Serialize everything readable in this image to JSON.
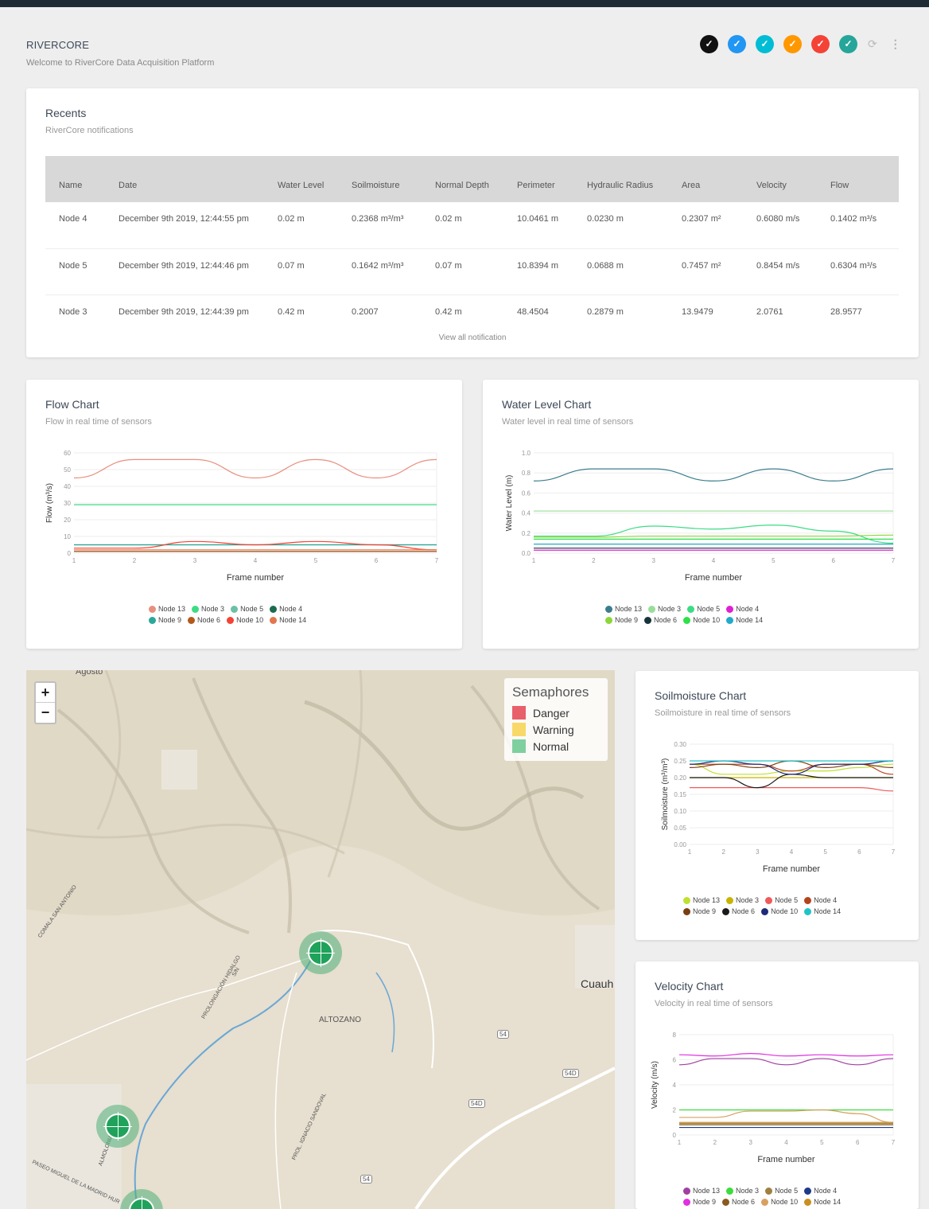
{
  "header": {
    "brand": "RIVERCORE",
    "welcome": "Welcome to RiverCore Data Acquisition Platform",
    "theme_colors": [
      "#111111",
      "#2196f3",
      "#00bcd4",
      "#ff9800",
      "#f44336",
      "#26a69a"
    ],
    "check_icon": "check-icon",
    "refresh_icon": "refresh-icon",
    "more_icon": "more-vert-icon"
  },
  "recents": {
    "title": "Recents",
    "subtitle": "RiverCore notifications",
    "columns": [
      "Name",
      "Date",
      "Water Level",
      "Soilmoisture",
      "Normal Depth",
      "Perimeter",
      "Hydraulic Radius",
      "Area",
      "Velocity",
      "Flow"
    ],
    "rows": [
      [
        "Node 4",
        "December 9th 2019, 12:44:55 pm",
        "0.02 m",
        "0.2368 m³/m³",
        "0.02 m",
        "10.0461 m",
        "0.0230 m",
        "0.2307 m²",
        "0.6080 m/s",
        "0.1402 m³/s"
      ],
      [
        "Node 5",
        "December 9th 2019, 12:44:46 pm",
        "0.07 m",
        "0.1642 m³/m³",
        "0.07 m",
        "10.8394 m",
        "0.0688 m",
        "0.7457 m²",
        "0.8454 m/s",
        "0.6304 m³/s"
      ],
      [
        "Node 3",
        "December 9th 2019, 12:44:39 pm",
        "0.42 m",
        "0.2007",
        "0.42 m",
        "48.4504",
        "0.2879 m",
        "13.9479",
        "2.0761",
        "28.9577"
      ]
    ],
    "view_all": "View all notification"
  },
  "charts_text": {
    "flow": {
      "title": "Flow Chart",
      "subtitle": "Flow in real time of sensors"
    },
    "water": {
      "title": "Water Level Chart",
      "subtitle": "Water level in real time of sensors"
    },
    "soil": {
      "title": "Soilmoisture Chart",
      "subtitle": "Soilmoisture in real time of sensors"
    },
    "velocity": {
      "title": "Velocity Chart",
      "subtitle": "Velocity in real time of sensors"
    }
  },
  "chart_data": [
    {
      "id": "flow",
      "type": "line",
      "xlabel": "Frame number",
      "ylabel": "Flow (m³/s)",
      "x": [
        1,
        2,
        3,
        4,
        5,
        6,
        7
      ],
      "ylim": [
        0,
        60
      ],
      "yticks": [
        0,
        10,
        20,
        30,
        40,
        50,
        60
      ],
      "series": [
        {
          "name": "Node 13",
          "color": "#e8907f",
          "values": [
            45,
            56,
            56,
            45,
            56,
            45,
            56
          ]
        },
        {
          "name": "Node 3",
          "color": "#3ddc84",
          "values": [
            29,
            29,
            29,
            29,
            29,
            29,
            29
          ]
        },
        {
          "name": "Node 5",
          "color": "#6cc0a8",
          "values": [
            5,
            5,
            5,
            5,
            5,
            5,
            5
          ]
        },
        {
          "name": "Node 4",
          "color": "#1c6b50",
          "values": [
            1,
            1,
            1,
            1,
            1,
            1,
            1
          ]
        },
        {
          "name": "Node 9",
          "color": "#2aa89a",
          "values": [
            5,
            5,
            5,
            5,
            5,
            5,
            5
          ]
        },
        {
          "name": "Node 6",
          "color": "#b25a1c",
          "values": [
            1,
            1,
            1,
            1,
            1,
            1,
            1
          ]
        },
        {
          "name": "Node 10",
          "color": "#f44336",
          "values": [
            3,
            3,
            7,
            5,
            7,
            5,
            2
          ]
        },
        {
          "name": "Node 14",
          "color": "#e2774f",
          "values": [
            2,
            2,
            2,
            2,
            2,
            2,
            2
          ]
        }
      ]
    },
    {
      "id": "water",
      "type": "line",
      "xlabel": "Frame number",
      "ylabel": "Water Level (m)",
      "x": [
        1,
        2,
        3,
        4,
        5,
        6,
        7
      ],
      "ylim": [
        0,
        1.0
      ],
      "yticks": [
        0.0,
        0.2,
        0.4,
        0.6,
        0.8,
        1.0
      ],
      "series": [
        {
          "name": "Node 13",
          "color": "#3c7d8c",
          "values": [
            0.72,
            0.84,
            0.84,
            0.72,
            0.84,
            0.72,
            0.84
          ]
        },
        {
          "name": "Node 3",
          "color": "#99dd99",
          "values": [
            0.42,
            0.42,
            0.42,
            0.42,
            0.42,
            0.42,
            0.42
          ]
        },
        {
          "name": "Node 5",
          "color": "#3ddc84",
          "values": [
            0.17,
            0.17,
            0.27,
            0.24,
            0.28,
            0.22,
            0.1
          ]
        },
        {
          "name": "Node 4",
          "color": "#e020d0",
          "values": [
            0.03,
            0.03,
            0.03,
            0.03,
            0.03,
            0.03,
            0.03
          ]
        },
        {
          "name": "Node 9",
          "color": "#8cd63a",
          "values": [
            0.16,
            0.16,
            0.17,
            0.17,
            0.17,
            0.17,
            0.18
          ]
        },
        {
          "name": "Node 6",
          "color": "#17343b",
          "values": [
            0.05,
            0.05,
            0.05,
            0.05,
            0.05,
            0.05,
            0.05
          ]
        },
        {
          "name": "Node 10",
          "color": "#2ee04a",
          "values": [
            0.14,
            0.14,
            0.14,
            0.14,
            0.14,
            0.14,
            0.14
          ]
        },
        {
          "name": "Node 14",
          "color": "#22aac8",
          "values": [
            0.09,
            0.09,
            0.09,
            0.09,
            0.09,
            0.09,
            0.09
          ]
        }
      ]
    },
    {
      "id": "soil",
      "type": "line",
      "xlabel": "Frame number",
      "ylabel": "Soilmoisture (m³/m³)",
      "x": [
        1,
        2,
        3,
        4,
        5,
        6,
        7
      ],
      "ylim": [
        0,
        0.3
      ],
      "yticks": [
        0.0,
        0.05,
        0.1,
        0.15,
        0.2,
        0.25,
        0.3
      ],
      "series": [
        {
          "name": "Node 13",
          "color": "#c0e030",
          "values": [
            0.24,
            0.21,
            0.21,
            0.22,
            0.22,
            0.23,
            0.24
          ]
        },
        {
          "name": "Node 3",
          "color": "#c8b400",
          "values": [
            0.2,
            0.2,
            0.2,
            0.2,
            0.2,
            0.2,
            0.2
          ]
        },
        {
          "name": "Node 5",
          "color": "#ef5a5a",
          "values": [
            0.17,
            0.17,
            0.17,
            0.17,
            0.17,
            0.17,
            0.16
          ]
        },
        {
          "name": "Node 4",
          "color": "#b4441c",
          "values": [
            0.24,
            0.24,
            0.24,
            0.22,
            0.24,
            0.24,
            0.21
          ]
        },
        {
          "name": "Node 9",
          "color": "#7a3e10",
          "values": [
            0.23,
            0.24,
            0.23,
            0.25,
            0.23,
            0.24,
            0.23
          ]
        },
        {
          "name": "Node 6",
          "color": "#1a1a1a",
          "values": [
            0.2,
            0.2,
            0.17,
            0.21,
            0.2,
            0.2,
            0.2
          ]
        },
        {
          "name": "Node 10",
          "color": "#1e2a78",
          "values": [
            0.24,
            0.25,
            0.24,
            0.21,
            0.24,
            0.24,
            0.25
          ]
        },
        {
          "name": "Node 14",
          "color": "#20c4c8",
          "values": [
            0.25,
            0.25,
            0.25,
            0.25,
            0.25,
            0.25,
            0.25
          ]
        }
      ]
    },
    {
      "id": "velocity",
      "type": "line",
      "xlabel": "Frame number",
      "ylabel": "Velocity (m/s)",
      "x": [
        1,
        2,
        3,
        4,
        5,
        6,
        7
      ],
      "ylim": [
        0,
        8
      ],
      "yticks": [
        0,
        2,
        4,
        6,
        8
      ],
      "series": [
        {
          "name": "Node 13",
          "color": "#a040a0",
          "values": [
            5.6,
            6.1,
            6.1,
            5.6,
            6.1,
            5.6,
            6.1
          ]
        },
        {
          "name": "Node 3",
          "color": "#3ddc3d",
          "values": [
            2.0,
            2.0,
            2.0,
            2.0,
            2.0,
            2.0,
            2.0
          ]
        },
        {
          "name": "Node 5",
          "color": "#a08040",
          "values": [
            0.8,
            0.8,
            0.8,
            0.8,
            0.8,
            0.8,
            0.8
          ]
        },
        {
          "name": "Node 4",
          "color": "#1e3a8a",
          "values": [
            0.6,
            0.6,
            0.6,
            0.6,
            0.6,
            0.6,
            0.6
          ]
        },
        {
          "name": "Node 9",
          "color": "#e030e0",
          "values": [
            6.4,
            6.3,
            6.5,
            6.3,
            6.4,
            6.3,
            6.4
          ]
        },
        {
          "name": "Node 6",
          "color": "#8a5a20",
          "values": [
            0.9,
            0.9,
            0.9,
            0.9,
            0.9,
            0.9,
            0.9
          ]
        },
        {
          "name": "Node 10",
          "color": "#d8a060",
          "values": [
            1.4,
            1.4,
            1.9,
            1.9,
            2.0,
            1.7,
            1.0
          ]
        },
        {
          "name": "Node 14",
          "color": "#c89020",
          "values": [
            1.0,
            1.0,
            1.0,
            1.0,
            1.0,
            1.0,
            1.0
          ]
        }
      ]
    }
  ],
  "map": {
    "zoom_in": "+",
    "zoom_out": "−",
    "semaphores_title": "Semaphores",
    "semaphores": [
      {
        "label": "Danger",
        "color": "#e8606a"
      },
      {
        "label": "Warning",
        "color": "#f8d868"
      },
      {
        "label": "Normal",
        "color": "#7fcf9f"
      }
    ],
    "labels": {
      "top": "Agosto",
      "city": "Cuauh",
      "town": "ALTOZANO",
      "road1": "COMALA SAN ANTONIO",
      "road2": "PROLONGACIÓN HIDALGO",
      "road3": "PROL. IGNACIO SANDOVAL",
      "road4": "PASEO MIGUEL DE LA MADRID HUR",
      "road5": "ALMOLONIA",
      "sn": "S/N",
      "shield1": "54",
      "shield2": "54D",
      "shield3": "54D",
      "shield4": "54"
    }
  }
}
